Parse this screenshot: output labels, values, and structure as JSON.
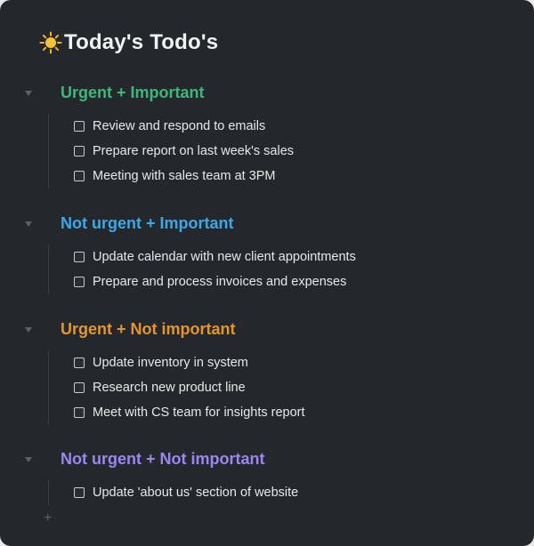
{
  "page": {
    "title_emoji": "sun-icon",
    "title": "Today's Todo's"
  },
  "colors": {
    "background": "#24282c",
    "urgent_important": "#3fb67b",
    "not_urgent_important": "#3aa9e8",
    "urgent_not_important": "#e5952e",
    "not_urgent_not_important": "#9d86f0"
  },
  "sections": [
    {
      "title": "Urgent + Important",
      "items": [
        {
          "label": "Review and respond to emails",
          "checked": false
        },
        {
          "label": "Prepare report on last week's sales",
          "checked": false
        },
        {
          "label": "Meeting with sales team at 3PM",
          "checked": false
        }
      ]
    },
    {
      "title": "Not urgent + Important",
      "items": [
        {
          "label": "Update calendar with new client appointments",
          "checked": false
        },
        {
          "label": "Prepare and process invoices and expenses",
          "checked": false
        }
      ]
    },
    {
      "title": "Urgent + Not important",
      "items": [
        {
          "label": "Update inventory in system",
          "checked": false
        },
        {
          "label": "Research new product line",
          "checked": false
        },
        {
          "label": "Meet with CS team for insights report",
          "checked": false
        }
      ]
    },
    {
      "title": "Not urgent + Not important",
      "items": [
        {
          "label": "Update 'about us' section of website",
          "checked": false
        }
      ]
    }
  ],
  "footer": {
    "add_label": "+"
  }
}
